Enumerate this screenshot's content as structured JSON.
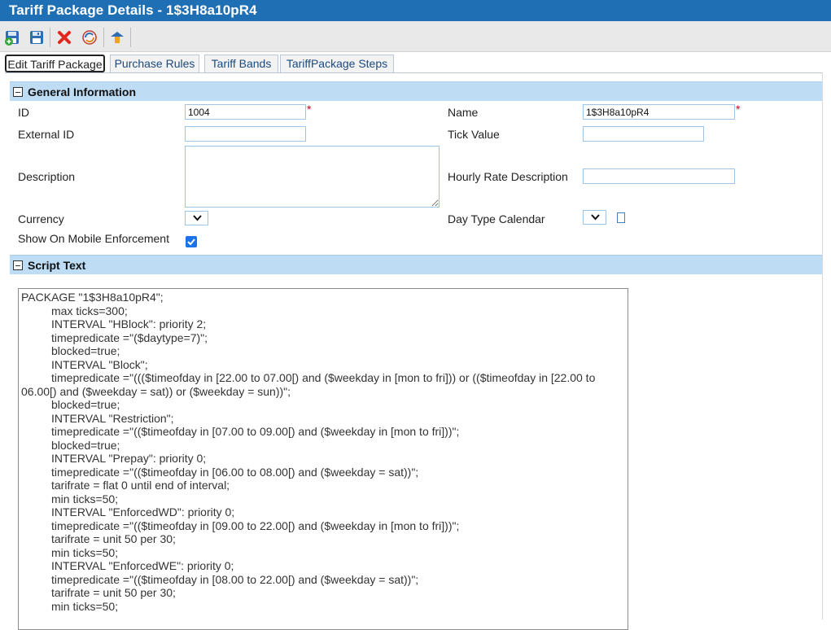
{
  "window": {
    "title": "Tariff Package Details - 1$3H8a10pR4"
  },
  "toolbar": {
    "buttons": [
      {
        "name": "save-new",
        "icon": "save-and-new-icon"
      },
      {
        "name": "save",
        "icon": "floppy-disk-icon"
      },
      {
        "name": "delete",
        "icon": "red-x-icon"
      },
      {
        "name": "refresh",
        "icon": "refresh-icon"
      },
      {
        "name": "back",
        "icon": "back-arrow-icon"
      }
    ]
  },
  "tabs": [
    {
      "label": "Edit Tariff Package",
      "active": true
    },
    {
      "label": "Purchase Rules",
      "active": false
    },
    {
      "label": "Tariff Bands",
      "active": false
    },
    {
      "label": "TariffPackage Steps",
      "active": false
    }
  ],
  "general": {
    "title": "General Information",
    "id_label": "ID",
    "id_value": "1004",
    "name_label": "Name",
    "name_value": "1$3H8a10pR4",
    "external_id_label": "External ID",
    "external_id_value": "",
    "tick_value_label": "Tick Value",
    "tick_value_value": "",
    "description_label": "Description",
    "description_value": "",
    "hourly_rate_label": "Hourly Rate Description",
    "hourly_rate_value": "",
    "currency_label": "Currency",
    "day_type_label": "Day Type Calendar",
    "mobile_label": "Show On Mobile Enforcement",
    "mobile_checked": true,
    "required_mark": "*"
  },
  "script": {
    "title": "Script Text",
    "lines": [
      "PACKAGE \"1$3H8a10pR4\";",
      "\tmax ticks=300;",
      "\tINTERVAL \"HBlock\": priority 2;",
      "\ttimepredicate =\"($daytype=7)\";",
      "\tblocked=true;",
      "\tINTERVAL \"Block\";",
      "\ttimepredicate =\"((($timeofday in [22.00 to 07.00[) and ($weekday in [mon to fri])) or (($timeofday in [22.00 to 06.00[) and ($weekday = sat)) or ($weekday = sun))\";",
      "\tblocked=true;",
      "\tINTERVAL \"Restriction\";",
      "\ttimepredicate =\"(($timeofday in [07.00 to 09.00[) and ($weekday in [mon to fri]))\";",
      "\tblocked=true;",
      "\tINTERVAL \"Prepay\": priority 0;",
      "\ttimepredicate =\"(($timeofday in [06.00 to 08.00[) and ($weekday = sat))\";",
      "\ttarifrate = flat 0 until end of interval;",
      "\tmin ticks=50;",
      "\tINTERVAL \"EnforcedWD\": priority 0;",
      "\ttimepredicate =\"(($timeofday in [09.00 to 22.00[) and ($weekday in [mon to fri]))\";",
      "\ttarifrate = unit 50 per 30;",
      "\tmin ticks=50;",
      "\tINTERVAL \"EnforcedWE\": priority 0;",
      "\ttimepredicate =\"(($timeofday in [08.00 to 22.00[) and ($weekday = sat))\";",
      "\ttarifrate = unit 50 per 30;",
      "\tmin ticks=50;"
    ]
  },
  "colors": {
    "title_bar": "#1f6fb5",
    "section_header": "#bfdcf5",
    "field_border": "#9ec5e8",
    "required": "#d0021b",
    "checkbox": "#1a73e8"
  }
}
